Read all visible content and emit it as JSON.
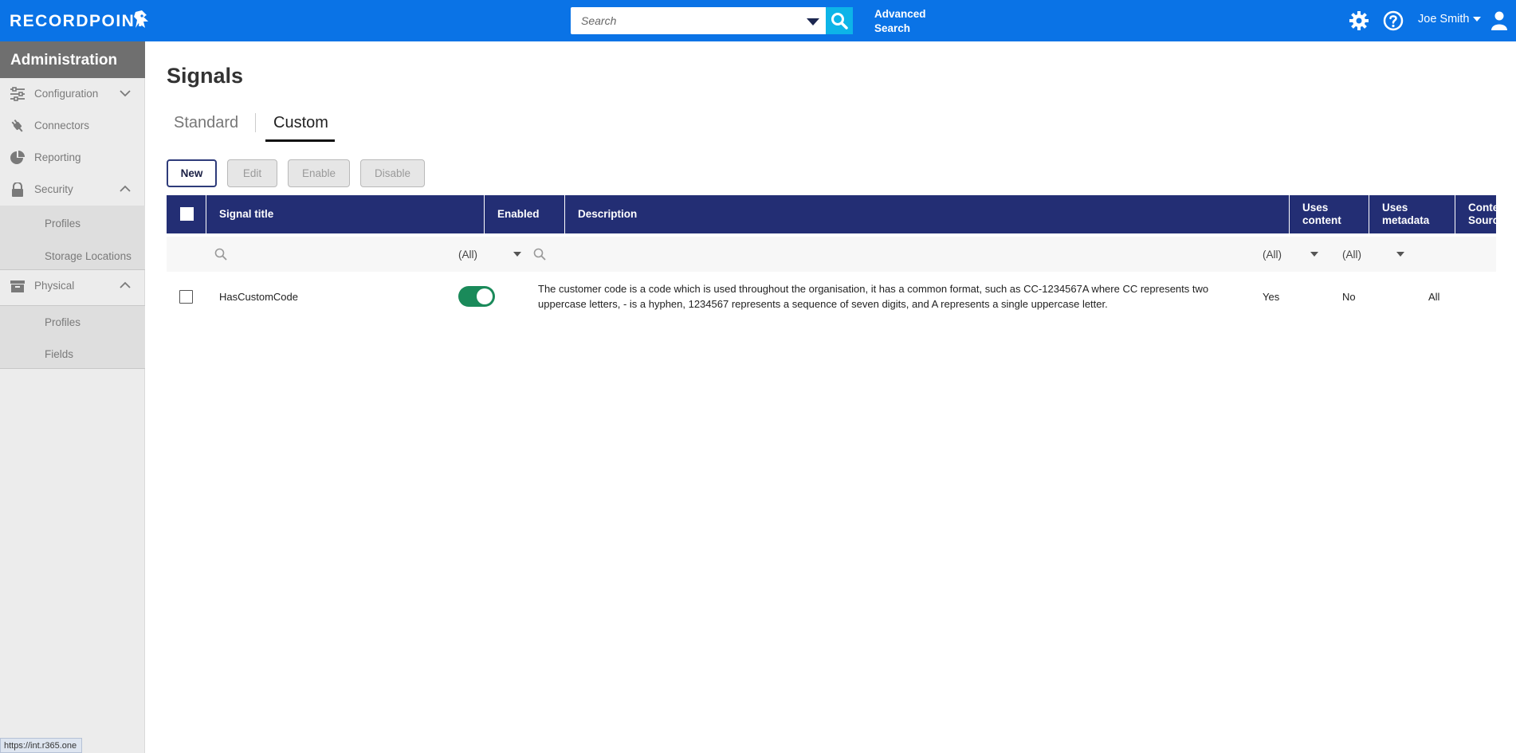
{
  "header": {
    "logo_text": "RECORDPOINT",
    "search": {
      "placeholder": "Search",
      "value": ""
    },
    "advanced_search_label": "Advanced Search",
    "user_name": "Joe Smith",
    "brand_color": "#0a73e6"
  },
  "sidebar": {
    "title": "Administration",
    "items": [
      {
        "label": "Configuration",
        "icon": "sliders-icon",
        "expanded": false
      },
      {
        "label": "Connectors",
        "icon": "plug-icon"
      },
      {
        "label": "Reporting",
        "icon": "pie-chart-icon"
      },
      {
        "label": "Security",
        "icon": "lock-icon",
        "expanded": true,
        "children": [
          "Profiles",
          "Storage Locations"
        ]
      },
      {
        "label": "Physical",
        "icon": "box-icon",
        "expanded": true,
        "children": [
          "Profiles",
          "Fields"
        ]
      }
    ]
  },
  "status_url": "https://int.r365.one",
  "page": {
    "title": "Signals",
    "tabs": [
      {
        "label": "Standard",
        "active": false
      },
      {
        "label": "Custom",
        "active": true
      }
    ],
    "toolbar": {
      "new": "New",
      "edit": "Edit",
      "enable": "Enable",
      "disable": "Disable"
    }
  },
  "table": {
    "header_color": "#232e74",
    "columns": [
      "Signal title",
      "Enabled",
      "Description",
      "Uses content",
      "Uses metadata",
      "Content Source"
    ],
    "filters": {
      "enabled": "(All)",
      "uses_content": "(All)",
      "uses_metadata": "(All)"
    },
    "rows": [
      {
        "title": "HasCustomCode",
        "enabled": true,
        "description": "The customer code is a code which is used throughout the organisation, it has a common format, such as  CC-1234567A where CC represents two uppercase letters, - is a hyphen, 1234567 represents a sequence of seven digits, and A represents a single uppercase letter.",
        "uses_content": "Yes",
        "uses_metadata": "No",
        "content_source": "All"
      }
    ]
  }
}
